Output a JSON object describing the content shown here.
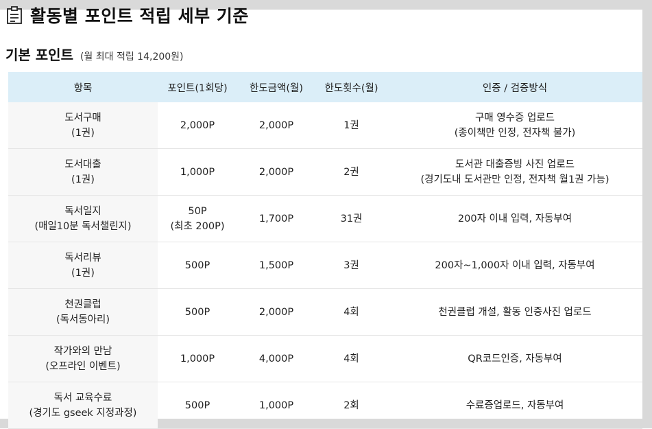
{
  "page": {
    "title": "활동별 포인트 적립 세부 기준",
    "subtitle": "기본 포인트",
    "subtitle_note": "(월 최대 적립 14,200원)"
  },
  "table": {
    "headers": [
      "항목",
      "포인트(1회당)",
      "한도금액(월)",
      "한도횟수(월)",
      "인증 / 검증방식"
    ],
    "rows": [
      {
        "item": [
          "도서구매",
          "(1권)"
        ],
        "point": [
          "2,000P"
        ],
        "limit_amount": "2,000P",
        "limit_count": "1권",
        "method": [
          "구매 영수증 업로드",
          "(종이책만 인정, 전자책 불가)"
        ]
      },
      {
        "item": [
          "도서대출",
          "(1권)"
        ],
        "point": [
          "1,000P"
        ],
        "limit_amount": "2,000P",
        "limit_count": "2권",
        "method": [
          "도서관 대출증빙 사진 업로드",
          "(경기도내 도서관만 인정, 전자책 월1권 가능)"
        ]
      },
      {
        "item": [
          "독서일지",
          "(매일10분 독서챌린지)"
        ],
        "point": [
          "50P",
          "(최초 200P)"
        ],
        "limit_amount": "1,700P",
        "limit_count": "31권",
        "method": [
          "200자 이내 입력, 자동부여"
        ]
      },
      {
        "item": [
          "독서리뷰",
          "(1권)"
        ],
        "point": [
          "500P"
        ],
        "limit_amount": "1,500P",
        "limit_count": "3권",
        "method": [
          "200자~1,000자 이내 입력, 자동부여"
        ]
      },
      {
        "item": [
          "천권클럽",
          "(독서동아리)"
        ],
        "point": [
          "500P"
        ],
        "limit_amount": "2,000P",
        "limit_count": "4회",
        "method": [
          "천권클럽 개설, 활동 인증사진 업로드"
        ]
      },
      {
        "item": [
          "작가와의 만남",
          "(오프라인 이벤트)"
        ],
        "point": [
          "1,000P"
        ],
        "limit_amount": "4,000P",
        "limit_count": "4회",
        "method": [
          "QR코드인증, 자동부여"
        ]
      },
      {
        "item": [
          "독서 교육수료",
          "(경기도 gseek 지정과정)"
        ],
        "point": [
          "500P"
        ],
        "limit_amount": "1,000P",
        "limit_count": "2회",
        "method": [
          "수료증업로드, 자동부여"
        ]
      }
    ]
  },
  "icons": {
    "title_icon": "clipboard-icon"
  }
}
